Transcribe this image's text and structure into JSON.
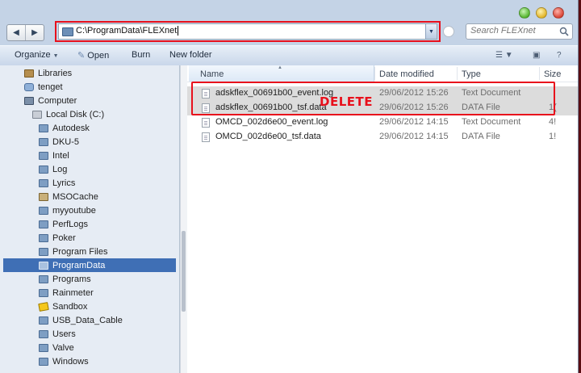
{
  "address": {
    "path": "C:\\ProgramData\\FLEXnet"
  },
  "search": {
    "placeholder": "Search FLEXnet"
  },
  "toolbar": {
    "organize": "Organize",
    "open": "Open",
    "burn": "Burn",
    "new_folder": "New folder"
  },
  "tree": [
    {
      "label": "Libraries",
      "icon": "library-icon"
    },
    {
      "label": "tenget",
      "icon": "user-folder-icon"
    },
    {
      "label": "Computer",
      "icon": "computer-icon"
    },
    {
      "label": "Local Disk (C:)",
      "icon": "disk-icon"
    },
    {
      "label": "Autodesk",
      "icon": "folder-icon"
    },
    {
      "label": "DKU-5",
      "icon": "folder-icon"
    },
    {
      "label": "Intel",
      "icon": "folder-icon"
    },
    {
      "label": "Log",
      "icon": "folder-icon"
    },
    {
      "label": "Lyrics",
      "icon": "folder-icon"
    },
    {
      "label": "MSOCache",
      "icon": "locked-folder-icon"
    },
    {
      "label": "myyoutube",
      "icon": "folder-icon"
    },
    {
      "label": "PerfLogs",
      "icon": "folder-icon"
    },
    {
      "label": "Poker",
      "icon": "folder-icon"
    },
    {
      "label": "Program Files",
      "icon": "folder-icon"
    },
    {
      "label": "ProgramData",
      "icon": "folder-icon",
      "selected": true
    },
    {
      "label": "Programs",
      "icon": "folder-icon"
    },
    {
      "label": "Rainmeter",
      "icon": "folder-icon"
    },
    {
      "label": "Sandbox",
      "icon": "sandbox-icon"
    },
    {
      "label": "USB_Data_Cable",
      "icon": "folder-icon"
    },
    {
      "label": "Users",
      "icon": "folder-icon"
    },
    {
      "label": "Valve",
      "icon": "folder-icon"
    },
    {
      "label": "Windows",
      "icon": "folder-icon"
    }
  ],
  "columns": {
    "name": "Name",
    "date": "Date modified",
    "type": "Type",
    "size": "Size"
  },
  "files": [
    {
      "name": "adskflex_00691b00_event.log",
      "date": "29/06/2012 15:26",
      "type": "Text Document",
      "size": ""
    },
    {
      "name": "adskflex_00691b00_tsf.data",
      "date": "29/06/2012 15:26",
      "type": "DATA File",
      "size": "1("
    },
    {
      "name": "OMCD_002d6e00_event.log",
      "date": "29/06/2012 14:15",
      "type": "Text Document",
      "size": "4!"
    },
    {
      "name": "OMCD_002d6e00_tsf.data",
      "date": "29/06/2012 14:15",
      "type": "DATA File",
      "size": "1!"
    }
  ],
  "annotation": {
    "label": "DELETE",
    "color": "#e8101c"
  }
}
